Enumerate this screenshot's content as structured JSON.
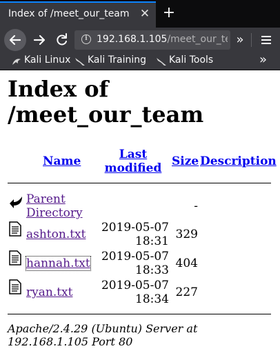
{
  "browser": {
    "tab_title": "Index of /meet_our_team",
    "url_host": "192.168.1.105",
    "url_path": "/meet_our_te",
    "bookmarks": [
      {
        "label": "Kali Linux",
        "icon": "kali-icon"
      },
      {
        "label": "Kali Training",
        "icon": "kali-dragon-icon"
      },
      {
        "label": "Kali Tools",
        "icon": "kali-dragon-icon"
      }
    ]
  },
  "page": {
    "title": "Index of /meet_our_team",
    "columns": {
      "name": "Name",
      "last_modified": "Last modified",
      "size": "Size",
      "description": "Description"
    },
    "rows": [
      {
        "name": "Parent Directory",
        "modified": "",
        "size": "-",
        "description": "",
        "icon": "back-arrow-icon"
      },
      {
        "name": "ashton.txt",
        "modified": "2019-05-07 18:31",
        "size": "329",
        "description": "",
        "icon": "text-file-icon"
      },
      {
        "name": "hannah.txt",
        "modified": "2019-05-07 18:33",
        "size": "404",
        "description": "",
        "icon": "text-file-icon"
      },
      {
        "name": "ryan.txt",
        "modified": "2019-05-07 18:34",
        "size": "227",
        "description": "",
        "icon": "text-file-icon"
      }
    ],
    "footer": "Apache/2.4.29 (Ubuntu) Server at 192.168.1.105 Port 80"
  }
}
